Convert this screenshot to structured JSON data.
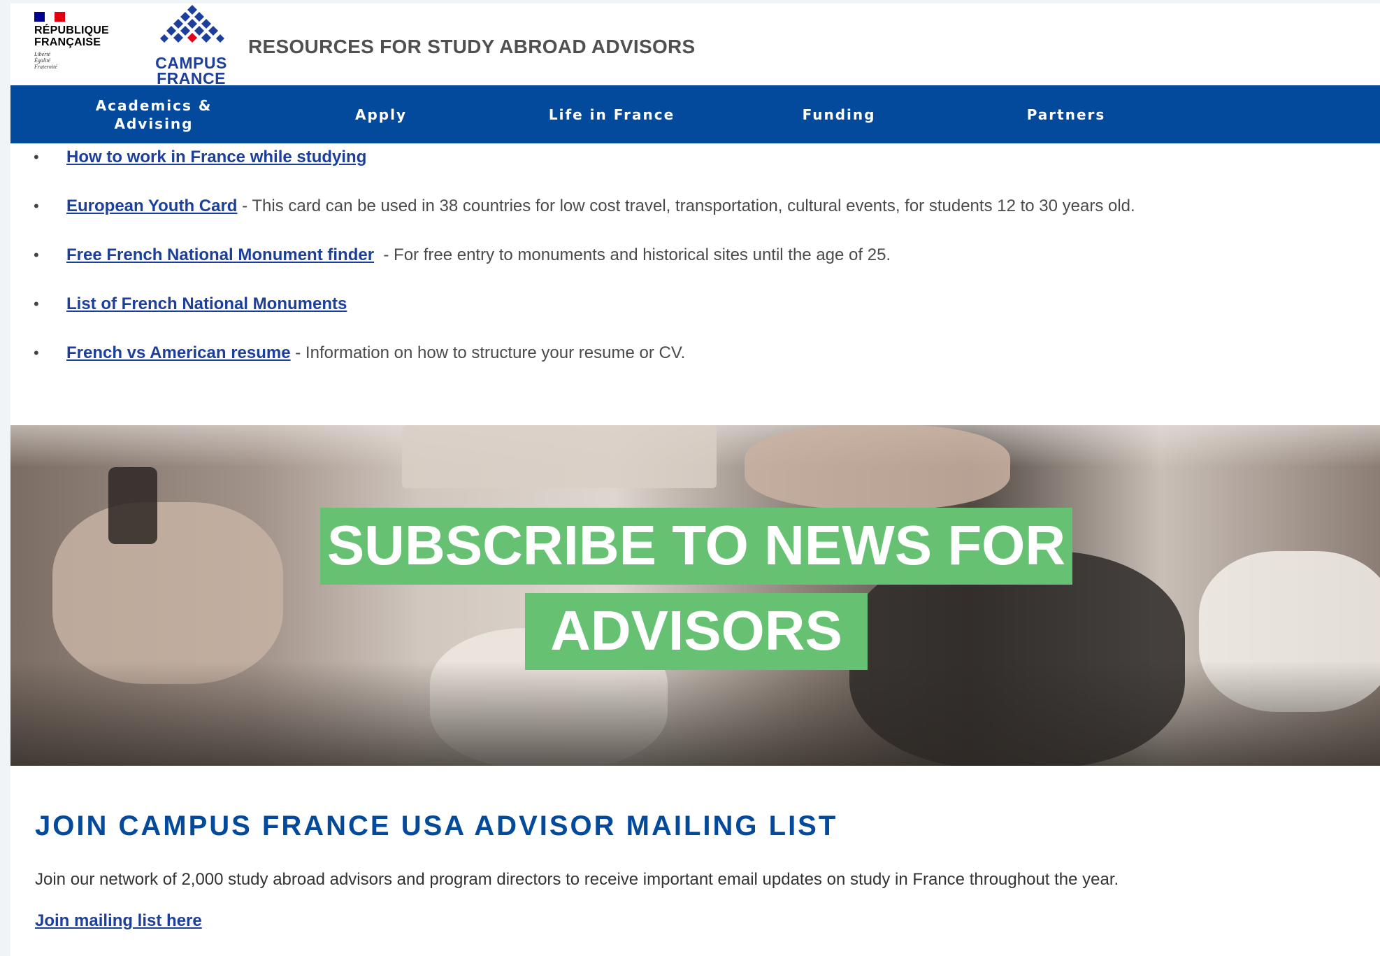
{
  "header": {
    "republic_line1": "RÉPUBLIQUE",
    "republic_line2": "FRANÇAISE",
    "motto_line1": "Liberté",
    "motto_line2": "Égalité",
    "motto_line3": "Fraternité",
    "brand_line1": "CAMPUS",
    "brand_line2": "FRANCE",
    "site_title": "RESOURCES FOR STUDY ABROAD ADVISORS",
    "colors": {
      "flag_blue": "#000091",
      "flag_white": "#ffffff",
      "flag_red": "#e1000f",
      "brand_blue": "#1d3f9c",
      "brand_red": "#e2001a"
    }
  },
  "nav": {
    "items": [
      {
        "line1": "Academics &",
        "line2": "Advising"
      },
      {
        "line1": "Apply",
        "line2": ""
      },
      {
        "line1": "Life in France",
        "line2": ""
      },
      {
        "line1": "Funding",
        "line2": ""
      },
      {
        "line1": "Partners",
        "line2": ""
      }
    ],
    "color": "#044a9c"
  },
  "resources": [
    {
      "link": "How to work in France while studying",
      "desc": ""
    },
    {
      "link": "European Youth Card",
      "desc": " - This card can be used in 38 countries for low cost travel, transportation, cultural events, for students 12 to 30 years old."
    },
    {
      "link": "Free French National Monument finder",
      "desc": "  - For free entry to monuments and historical sites until the age of 25."
    },
    {
      "link": "List of French National Monuments",
      "desc": ""
    },
    {
      "link": "French vs American resume",
      "desc": " - Information on how to structure your resume or CV."
    }
  ],
  "banner": {
    "line1": "SUBSCRIBE TO NEWS FOR",
    "line2": "ADVISORS",
    "accent": "#66c172"
  },
  "mailing": {
    "heading": "JOIN CAMPUS FRANCE USA ADVISOR MAILING LIST",
    "text": "Join our network of 2,000 study abroad advisors and program directors to receive important email updates on study in France throughout the year.",
    "link": "Join mailing list here"
  }
}
